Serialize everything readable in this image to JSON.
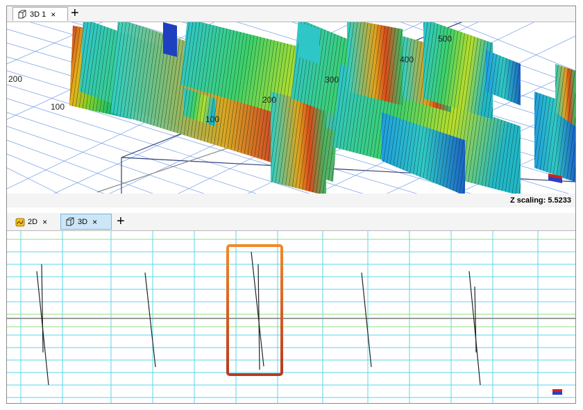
{
  "top_pane": {
    "tabs": [
      {
        "label": "3D 1",
        "close": "×"
      }
    ],
    "add_tab": "+",
    "axis_labels": [
      "200",
      "100",
      "200",
      "100",
      "300",
      "400",
      "500"
    ]
  },
  "status_bar": {
    "z_scaling": "Z scaling: 5.5233"
  },
  "bottom_pane": {
    "tabs": [
      {
        "label": "2D",
        "close": "×"
      },
      {
        "label": "3D",
        "close": "×"
      }
    ],
    "add_tab": "+"
  },
  "colors": {
    "grid": "#5ad7e8",
    "selection_top": "#f08a2a",
    "selection_bottom": "#b93a1f",
    "tab_selected": "#cde6f7"
  }
}
